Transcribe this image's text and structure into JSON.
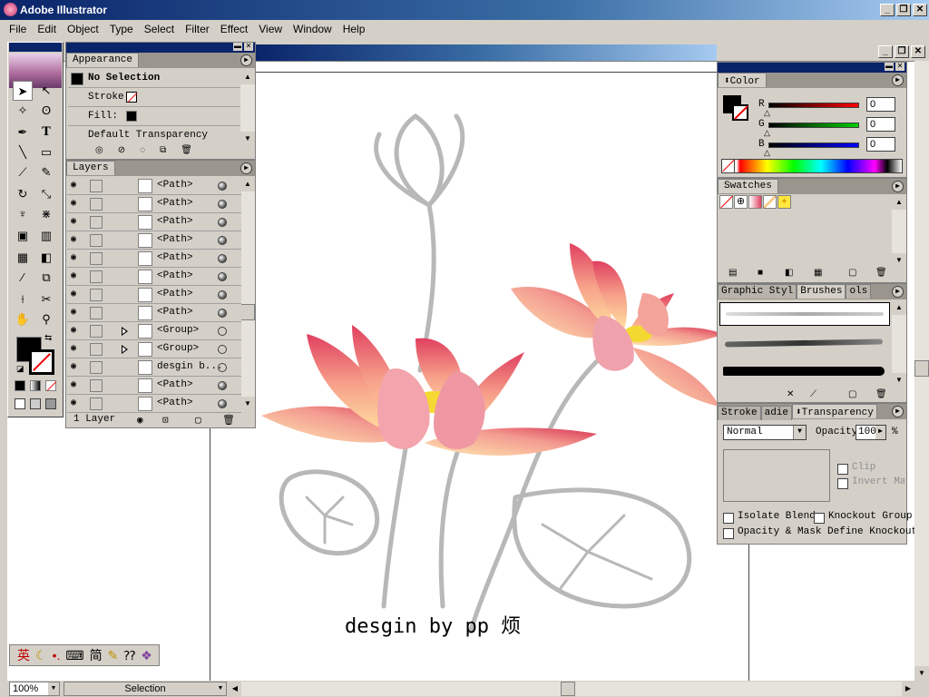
{
  "app": {
    "title": "Adobe Illustrator"
  },
  "menu": [
    "File",
    "Edit",
    "Object",
    "Type",
    "Select",
    "Filter",
    "Effect",
    "View",
    "Window",
    "Help"
  ],
  "appearance": {
    "tab": "Appearance",
    "selection": "No Selection",
    "stroke_label": "Stroke:",
    "fill_label": "Fill:",
    "transparency": "Default Transparency"
  },
  "layers": {
    "tab": "Layers",
    "rows": [
      {
        "name": "<Path>",
        "filled": true
      },
      {
        "name": "<Path>",
        "filled": true
      },
      {
        "name": "<Path>",
        "filled": true
      },
      {
        "name": "<Path>",
        "filled": true
      },
      {
        "name": "<Path>",
        "filled": true
      },
      {
        "name": "<Path>",
        "filled": true
      },
      {
        "name": "<Path>",
        "filled": true
      },
      {
        "name": "<Path>",
        "filled": true
      },
      {
        "name": "<Group>",
        "filled": false,
        "group": true
      },
      {
        "name": "<Group>",
        "filled": false,
        "group": true
      },
      {
        "name": "desgin b...",
        "filled": false
      },
      {
        "name": "<Path>",
        "filled": true
      },
      {
        "name": "<Path>",
        "filled": true
      }
    ],
    "footer": "1 Layer"
  },
  "color": {
    "tab": "Color",
    "r_label": "R",
    "g_label": "G",
    "b_label": "B",
    "r": "0",
    "g": "0",
    "b": "0",
    "r_color": "#ff0000",
    "g_color": "#00c000",
    "b_color": "#0000ff"
  },
  "swatches": {
    "tab": "Swatches"
  },
  "brushes": {
    "tabs": [
      "Graphic Styl",
      "Brushes",
      "ols"
    ]
  },
  "transparency": {
    "tabs": [
      "Stroke",
      "adie",
      "Transparency"
    ],
    "mode": "Normal",
    "opacity_label": "Opacity",
    "opacity": "100",
    "percent": "%",
    "clip": "Clip",
    "invert_mask": "Invert Mas",
    "isolate_blend": "Isolate Blend",
    "knockout_group": "Knockout Group",
    "opacity_mask": "Opacity & Mask Define Knockout"
  },
  "canvas": {
    "caption": "desgin by pp 烦"
  },
  "ime": {
    "label": "英",
    "mode": "简"
  },
  "status": {
    "zoom": "100%",
    "tool": "Selection"
  }
}
